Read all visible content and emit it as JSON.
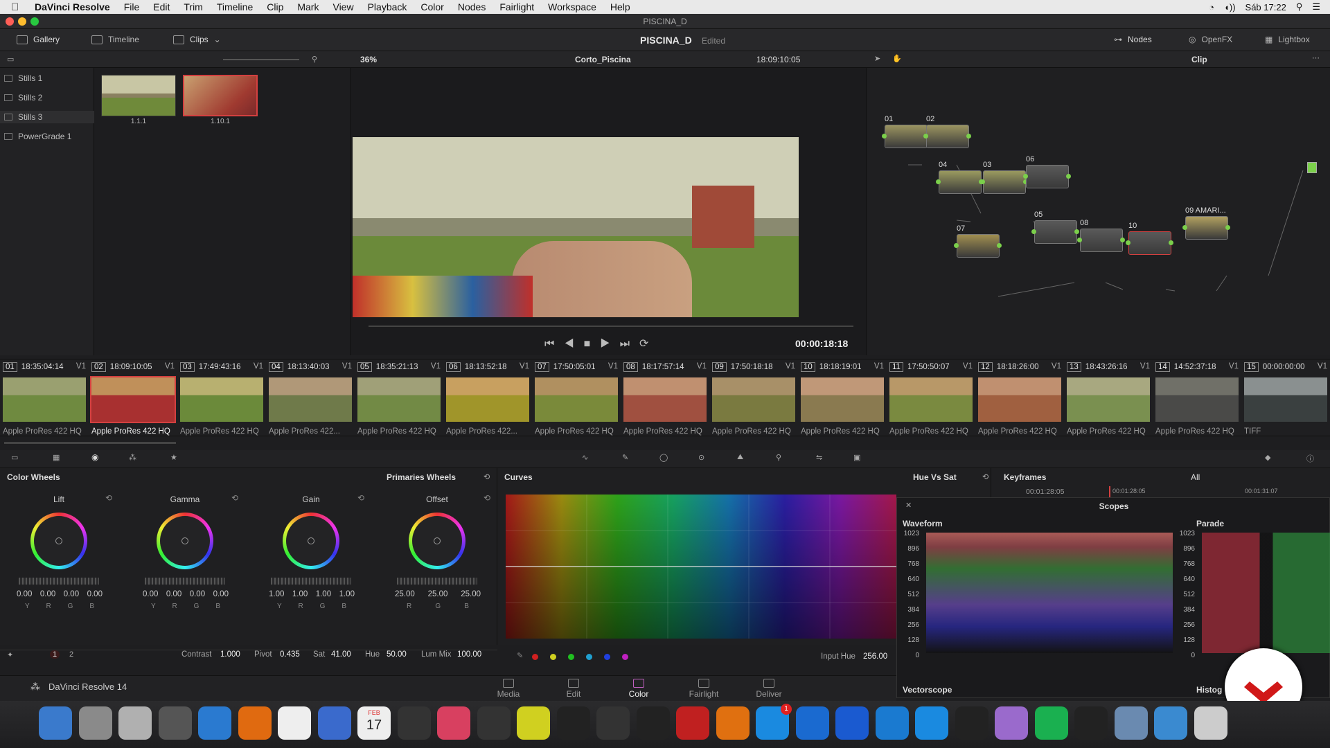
{
  "menubar": {
    "app": "DaVinci Resolve",
    "items": [
      "File",
      "Edit",
      "Trim",
      "Timeline",
      "Clip",
      "Mark",
      "View",
      "Playback",
      "Color",
      "Nodes",
      "Fairlight",
      "Workspace",
      "Help"
    ],
    "clock": "Sáb 17:22"
  },
  "window": {
    "title": "PISCINA_D"
  },
  "topbar": {
    "gallery": "Gallery",
    "timeline": "Timeline",
    "clips": "Clips",
    "project": "PISCINA_D",
    "status": "Edited",
    "nodes": "Nodes",
    "openfx": "OpenFX",
    "lightbox": "Lightbox"
  },
  "viewerbar": {
    "zoom": "36%",
    "clipname": "Corto_Piscina",
    "timecode": "18:09:10:05",
    "mode": "Clip"
  },
  "stills": [
    "Stills 1",
    "Stills 2",
    "Stills 3",
    "PowerGrade 1"
  ],
  "gallery": [
    {
      "label": "1.1.1"
    },
    {
      "label": "1.10.1"
    }
  ],
  "viewer": {
    "timecode": "00:00:18:18"
  },
  "nodes": [
    {
      "label": "01"
    },
    {
      "label": "02"
    },
    {
      "label": "03"
    },
    {
      "label": "04"
    },
    {
      "label": "05"
    },
    {
      "label": "06"
    },
    {
      "label": "07"
    },
    {
      "label": "08"
    },
    {
      "label": "09 AMARI..."
    },
    {
      "label": "10"
    }
  ],
  "clips": [
    {
      "n": "01",
      "tc": "18:35:04:14",
      "track": "V1",
      "codec": "Apple ProRes 422 HQ",
      "c1": "#9aa070",
      "c2": "#6f8a40"
    },
    {
      "n": "02",
      "tc": "18:09:10:05",
      "track": "V1",
      "codec": "Apple ProRes 422 HQ",
      "c1": "#c0905a",
      "c2": "#a83030"
    },
    {
      "n": "03",
      "tc": "17:49:43:16",
      "track": "V1",
      "codec": "Apple ProRes 422 HQ",
      "c1": "#b8b070",
      "c2": "#6b8a3a"
    },
    {
      "n": "04",
      "tc": "18:13:40:03",
      "track": "V1",
      "codec": "Apple ProRes 422...",
      "c1": "#b09878",
      "c2": "#6f7a4a"
    },
    {
      "n": "05",
      "tc": "18:35:21:13",
      "track": "V1",
      "codec": "Apple ProRes 422 HQ",
      "c1": "#a0a078",
      "c2": "#728a45"
    },
    {
      "n": "06",
      "tc": "18:13:52:18",
      "track": "V1",
      "codec": "Apple ProRes 422...",
      "c1": "#c8a060",
      "c2": "#a0952a"
    },
    {
      "n": "07",
      "tc": "17:50:05:01",
      "track": "V1",
      "codec": "Apple ProRes 422 HQ",
      "c1": "#b09060",
      "c2": "#7a8a3a"
    },
    {
      "n": "08",
      "tc": "18:17:57:14",
      "track": "V1",
      "codec": "Apple ProRes 422 HQ",
      "c1": "#c09070",
      "c2": "#a05040"
    },
    {
      "n": "09",
      "tc": "17:50:18:18",
      "track": "V1",
      "codec": "Apple ProRes 422 HQ",
      "c1": "#a89068",
      "c2": "#7a7a40"
    },
    {
      "n": "10",
      "tc": "18:18:19:01",
      "track": "V1",
      "codec": "Apple ProRes 422 HQ",
      "c1": "#c09878",
      "c2": "#8a7a50"
    },
    {
      "n": "11",
      "tc": "17:50:50:07",
      "track": "V1",
      "codec": "Apple ProRes 422 HQ",
      "c1": "#b89868",
      "c2": "#7a8a40"
    },
    {
      "n": "12",
      "tc": "18:18:26:00",
      "track": "V1",
      "codec": "Apple ProRes 422 HQ",
      "c1": "#c09070",
      "c2": "#a06040"
    },
    {
      "n": "13",
      "tc": "18:43:26:16",
      "track": "V1",
      "codec": "Apple ProRes 422 HQ",
      "c1": "#a8a880",
      "c2": "#7a9050"
    },
    {
      "n": "14",
      "tc": "14:52:37:18",
      "track": "V1",
      "codec": "Apple ProRes 422 HQ",
      "c1": "#707068",
      "c2": "#4a4a48"
    },
    {
      "n": "15",
      "tc": "00:00:00:00",
      "track": "V1",
      "codec": "TIFF",
      "c1": "#8a9090",
      "c2": "#3a4040"
    }
  ],
  "colorWheels": {
    "title": "Color Wheels",
    "mode": "Primaries Wheels",
    "wheels": [
      {
        "name": "Lift",
        "vals": [
          "0.00",
          "0.00",
          "0.00",
          "0.00"
        ],
        "labs": [
          "Y",
          "R",
          "G",
          "B"
        ]
      },
      {
        "name": "Gamma",
        "vals": [
          "0.00",
          "0.00",
          "0.00",
          "0.00"
        ],
        "labs": [
          "Y",
          "R",
          "G",
          "B"
        ]
      },
      {
        "name": "Gain",
        "vals": [
          "1.00",
          "1.00",
          "1.00",
          "1.00"
        ],
        "labs": [
          "Y",
          "R",
          "G",
          "B"
        ]
      },
      {
        "name": "Offset",
        "vals": [
          "25.00",
          "25.00",
          "25.00"
        ],
        "labs": [
          "R",
          "G",
          "B"
        ]
      }
    ],
    "page1": "1",
    "page2": "2",
    "contrastLabel": "Contrast",
    "contrast": "1.000",
    "pivotLabel": "Pivot",
    "pivot": "0.435",
    "satLabel": "Sat",
    "sat": "41.00",
    "hueLabel": "Hue",
    "hue": "50.00",
    "lummixLabel": "Lum Mix",
    "lummix": "100.00"
  },
  "curves": {
    "title": "Curves",
    "mode": "Hue Vs Sat",
    "inputHueLabel": "Input Hue",
    "inputHue": "256.00"
  },
  "keyframes": {
    "title": "Keyframes",
    "filter": "All",
    "tc1": "00:01:28:05",
    "tc2": "00:01:28:05",
    "tc3": "00:01:31:07"
  },
  "scopes": {
    "title": "Scopes",
    "waveform": "Waveform",
    "parade": "Parade",
    "vectorscope": "Vectorscope",
    "histogram": "Histog",
    "ticks": [
      "1023",
      "896",
      "768",
      "640",
      "512",
      "384",
      "256",
      "128",
      "0"
    ]
  },
  "bottom": {
    "app": "DaVinci Resolve 14",
    "pages": [
      "Media",
      "Edit",
      "Color",
      "Fairlight",
      "Deliver"
    ]
  },
  "dock": {
    "calendarMonth": "FEB",
    "calendarDay": "17",
    "badge": "1"
  }
}
